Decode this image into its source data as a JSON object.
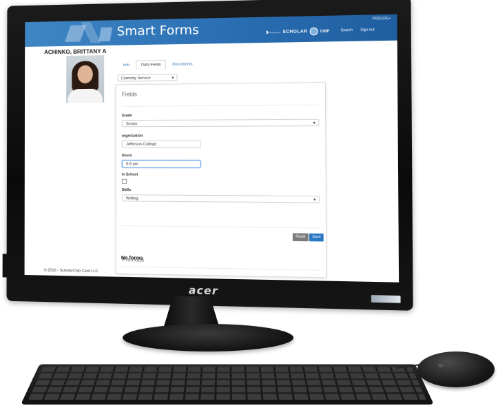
{
  "app": {
    "title": "Smart Forms",
    "top_right_label": "PROLOG+",
    "powered_by": "Powered by",
    "vendor_name": "SCHOLAR",
    "vendor_suffix": "CHIP",
    "nav": {
      "search": "Search",
      "sign_out": "Sign out"
    }
  },
  "student": {
    "name": "ACHINKO, BRITTANY A"
  },
  "tabs": [
    {
      "label": "Info",
      "active": false
    },
    {
      "label": "Data Fields",
      "active": true
    },
    {
      "label": "Documents",
      "active": false
    }
  ],
  "category_select": {
    "value": "Commity Service"
  },
  "panel": {
    "heading": "Fields",
    "fields": {
      "grade": {
        "label": "Grade",
        "value": "Senior"
      },
      "organization": {
        "label": "organization",
        "value": "Jefferson College"
      },
      "hours": {
        "label": "Hours",
        "value": "9-5 pm"
      },
      "in_school": {
        "label": "In School",
        "checked": false
      },
      "skills": {
        "label": "Skills",
        "value": "Writing"
      }
    },
    "buttons": {
      "reset": "Reset",
      "save": "Save"
    },
    "previous_heading": "Previous",
    "no_forms": "No forms"
  },
  "footer": "© 2016 - ScholarChip Card LLC",
  "hardware": {
    "brand": "acer"
  },
  "colors": {
    "header": "#2a6fb3",
    "primary_button": "#2a78c4",
    "reset_button": "#7b7b7b"
  }
}
